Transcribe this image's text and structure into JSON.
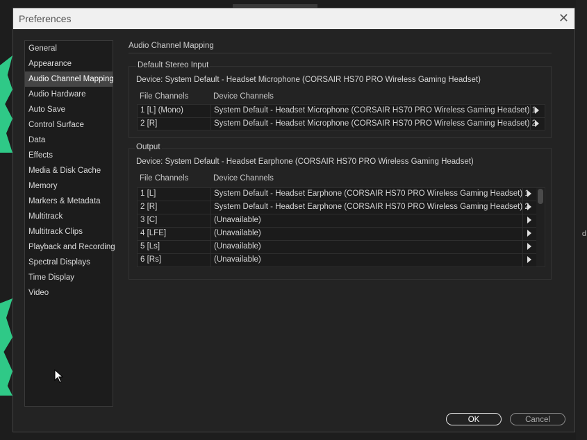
{
  "dialog": {
    "title": "Preferences",
    "close_glyph": "✕"
  },
  "sidebar": {
    "selected": "Audio Channel Mapping",
    "items": [
      {
        "label": "General"
      },
      {
        "label": "Appearance"
      },
      {
        "label": "Audio Channel Mapping"
      },
      {
        "label": "Audio Hardware"
      },
      {
        "label": "Auto Save"
      },
      {
        "label": "Control Surface"
      },
      {
        "label": "Data"
      },
      {
        "label": "Effects"
      },
      {
        "label": "Media & Disk Cache"
      },
      {
        "label": "Memory"
      },
      {
        "label": "Markers & Metadata"
      },
      {
        "label": "Multitrack"
      },
      {
        "label": "Multitrack Clips"
      },
      {
        "label": "Playback and Recording"
      },
      {
        "label": "Spectral Displays"
      },
      {
        "label": "Time Display"
      },
      {
        "label": "Video"
      }
    ]
  },
  "main": {
    "section_title": "Audio Channel Mapping",
    "input": {
      "group_label": "Default Stereo Input",
      "device": "Device: System Default - Headset Microphone (CORSAIR HS70 PRO Wireless Gaming Headset)",
      "col_file": "File Channels",
      "col_device": "Device Channels",
      "rows": [
        {
          "file": "1 [L] (Mono)",
          "device": "System Default - Headset Microphone (CORSAIR HS70 PRO Wireless Gaming Headset) 1"
        },
        {
          "file": "2 [R]",
          "device": "System Default - Headset Microphone (CORSAIR HS70 PRO Wireless Gaming Headset) 2"
        }
      ]
    },
    "output": {
      "group_label": "Output",
      "device": "Device: System Default - Headset Earphone (CORSAIR HS70 PRO Wireless Gaming Headset)",
      "col_file": "File Channels",
      "col_device": "Device Channels",
      "rows": [
        {
          "file": "1 [L]",
          "device": "System Default - Headset Earphone (CORSAIR HS70 PRO Wireless Gaming Headset) 1"
        },
        {
          "file": "2 [R]",
          "device": "System Default - Headset Earphone (CORSAIR HS70 PRO Wireless Gaming Headset) 2"
        },
        {
          "file": "3 [C]",
          "device": "(Unavailable)"
        },
        {
          "file": "4 [LFE]",
          "device": "(Unavailable)"
        },
        {
          "file": "5 [Ls]",
          "device": "(Unavailable)"
        },
        {
          "file": "6 [Rs]",
          "device": "(Unavailable)"
        }
      ]
    }
  },
  "buttons": {
    "ok": "OK",
    "cancel": "Cancel"
  },
  "background": {
    "side_char": "d",
    "wave_color": "#2fc987"
  }
}
